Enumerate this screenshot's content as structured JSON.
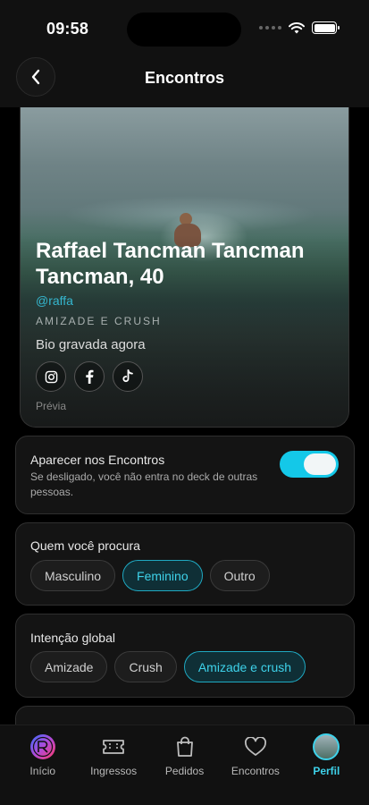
{
  "status_bar": {
    "time": "09:58"
  },
  "header": {
    "title": "Encontros"
  },
  "preview": {
    "name": "Raffael Tancman Tancman Tancman, 40",
    "handle": "@raffa",
    "intention": "AMIZADE E CRUSH",
    "bio": "Bio gravada agora",
    "socials": [
      "instagram-icon",
      "facebook-icon",
      "tiktok-icon"
    ],
    "footer": "Prévia"
  },
  "visibility": {
    "title": "Aparecer nos Encontros",
    "description": "Se desligado, você não entra no deck de outras pessoas.",
    "enabled": true,
    "accent": "#14c8e8"
  },
  "looking_for": {
    "title": "Quem você procura",
    "options": [
      "Masculino",
      "Feminino",
      "Outro"
    ],
    "selected": "Feminino"
  },
  "global_intention": {
    "title": "Intenção global",
    "options": [
      "Amizade",
      "Crush",
      "Amizade e crush"
    ],
    "selected": "Amizade e crush"
  },
  "tab_bar": {
    "items": [
      {
        "label": "Início",
        "icon": "logo-icon"
      },
      {
        "label": "Ingressos",
        "icon": "ticket-icon"
      },
      {
        "label": "Pedidos",
        "icon": "bag-icon"
      },
      {
        "label": "Encontros",
        "icon": "heart-icon"
      },
      {
        "label": "Perfil",
        "icon": "avatar"
      }
    ],
    "active": "Perfil",
    "accent": "#3ed2ea"
  }
}
